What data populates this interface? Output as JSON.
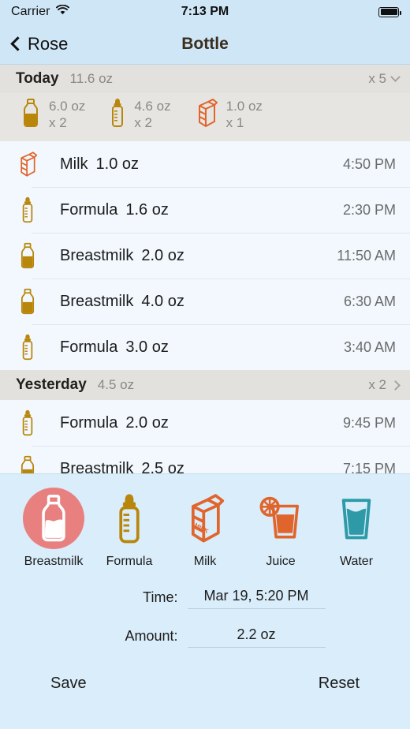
{
  "status_bar": {
    "carrier": "Carrier",
    "wifi_icon": "wifi-icon",
    "time": "7:13 PM",
    "battery_icon": "battery-full-icon"
  },
  "nav": {
    "back_label": "Rose",
    "back_icon": "chevron-left-icon",
    "title": "Bottle"
  },
  "sections": [
    {
      "title": "Today",
      "total": "11.6 oz",
      "count": "x 5",
      "chevron": "chevron-down-icon",
      "expanded": true,
      "summary": [
        {
          "icon": "breastmilk-bottle-icon",
          "amount": "6.0 oz",
          "count": "x 2"
        },
        {
          "icon": "formula-bottle-icon",
          "amount": "4.6 oz",
          "count": "x 2"
        },
        {
          "icon": "milk-carton-icon",
          "amount": "1.0 oz",
          "count": "x 1"
        }
      ],
      "entries": [
        {
          "icon": "milk-carton-icon",
          "label": "Milk",
          "amount": "1.0 oz",
          "time": "4:50 PM"
        },
        {
          "icon": "formula-bottle-icon",
          "label": "Formula",
          "amount": "1.6 oz",
          "time": "2:30 PM"
        },
        {
          "icon": "breastmilk-bottle-icon",
          "label": "Breastmilk",
          "amount": "2.0 oz",
          "time": "11:50 AM"
        },
        {
          "icon": "breastmilk-bottle-icon",
          "label": "Breastmilk",
          "amount": "4.0 oz",
          "time": "6:30 AM"
        },
        {
          "icon": "formula-bottle-icon",
          "label": "Formula",
          "amount": "3.0 oz",
          "time": "3:40 AM"
        }
      ]
    },
    {
      "title": "Yesterday",
      "total": "4.5 oz",
      "count": "x 2",
      "chevron": "chevron-right-icon",
      "expanded": false,
      "entries": [
        {
          "icon": "formula-bottle-icon",
          "label": "Formula",
          "amount": "2.0 oz",
          "time": "9:45 PM"
        },
        {
          "icon": "breastmilk-bottle-icon",
          "label": "Breastmilk",
          "amount": "2.5 oz",
          "time": "7:15 PM"
        }
      ]
    }
  ],
  "editor": {
    "types": [
      {
        "label": "Breastmilk",
        "icon": "breastmilk-bottle-icon",
        "selected": true
      },
      {
        "label": "Formula",
        "icon": "formula-bottle-icon",
        "selected": false
      },
      {
        "label": "Milk",
        "icon": "milk-carton-icon",
        "selected": false
      },
      {
        "label": "Juice",
        "icon": "juice-glass-icon",
        "selected": false
      },
      {
        "label": "Water",
        "icon": "water-glass-icon",
        "selected": false
      }
    ],
    "time_label": "Time:",
    "time_value": "Mar 19, 5:20 PM",
    "amount_label": "Amount:",
    "amount_value": "2.2 oz",
    "save_label": "Save",
    "reset_label": "Reset"
  },
  "colors": {
    "nav_bg": "#cfe6f7",
    "list_bg": "#f2f8fd",
    "section_bg": "#e3e1de",
    "editor_bg": "#daedfa",
    "gold": "#b8860b",
    "orange": "#e0652c",
    "teal": "#2e9aa8",
    "pink": "#e8807f"
  }
}
